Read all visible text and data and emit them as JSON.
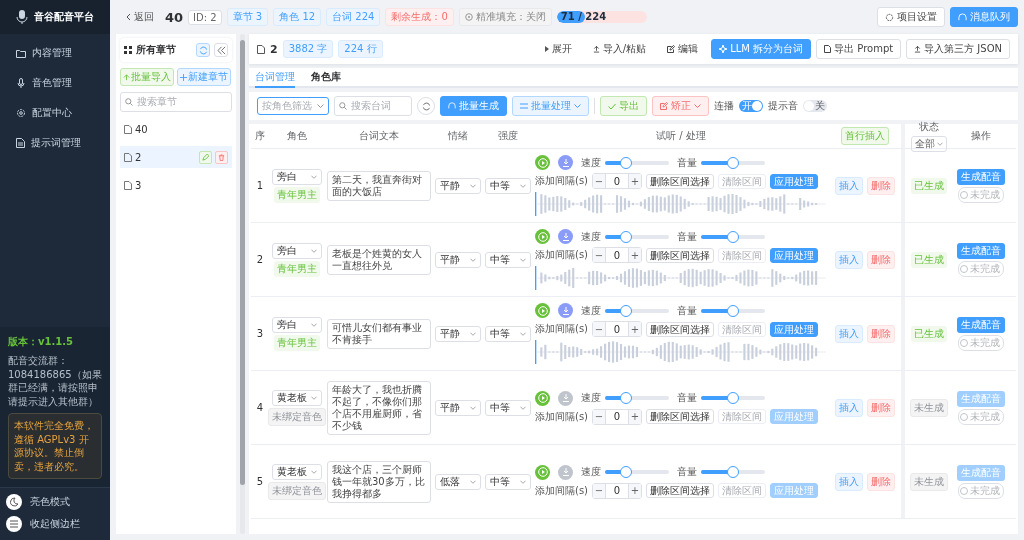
{
  "sidebar": {
    "logo": "音谷配音平台",
    "nav": [
      {
        "label": "内容管理",
        "kind": "folder",
        "selected": false
      },
      {
        "label": "音色管理",
        "kind": "mic",
        "selected": false
      },
      {
        "label": "配置中心",
        "kind": "gear",
        "selected": false
      },
      {
        "label": "提示词管理",
        "kind": "doc",
        "selected": false
      }
    ],
    "version": "版本：v1.1.5",
    "group_note": "配音交流群：1084186865（如果群已经满，请按照申请提示进入其他群）",
    "notice": "本软件完全免费，遵循 AGPLv3 开源协议。禁止倒卖，违者必究。",
    "bottom": [
      {
        "label": "亮色模式",
        "kind": "theme"
      },
      {
        "label": "收起侧边栏",
        "kind": "collapse"
      }
    ]
  },
  "topbar": {
    "back": "返回",
    "title": "40",
    "id": "ID: 2",
    "badges": [
      {
        "label": "章节 3",
        "kind": "info"
      },
      {
        "label": "角色 12",
        "kind": "info"
      },
      {
        "label": "台词 224",
        "kind": "info"
      },
      {
        "label": "剩余生成：0",
        "kind": "danger"
      }
    ],
    "precise": "精准填充：关闭",
    "progress": {
      "label": "71 / 224",
      "level": 0.317
    },
    "buttons": [
      {
        "label": "项目设置",
        "kind": "default"
      },
      {
        "label": "消息队列",
        "kind": "primary"
      }
    ]
  },
  "chapters": {
    "title": "所有章节",
    "import": "批量导入",
    "new": "新建章节",
    "search_placeholder": "搜索章节",
    "items": [
      {
        "name": "40",
        "selected": false
      },
      {
        "name": "2",
        "selected": true
      },
      {
        "name": "3",
        "selected": false
      }
    ]
  },
  "header": {
    "name": "2",
    "chars": "3882 字",
    "lines": "224 行",
    "actions": [
      {
        "label": "展开",
        "kind": "text"
      },
      {
        "label": "导入/粘贴",
        "kind": "text"
      },
      {
        "label": "编辑",
        "kind": "text"
      },
      {
        "label": "LLM 拆分为台词",
        "kind": "primary"
      },
      {
        "label": "导出 Prompt",
        "kind": "default"
      },
      {
        "label": "导入第三方 JSON",
        "kind": "default"
      }
    ]
  },
  "tabs": [
    {
      "label": "台词管理",
      "selected": true
    },
    {
      "label": "角色库",
      "selected": false
    }
  ],
  "toolbar": {
    "role_filter_placeholder": "按角色筛选",
    "search_placeholder": "搜索台词",
    "batch_generate": "批量生成",
    "batch_process": "批量处理",
    "export": "导出",
    "correct": "矫正",
    "autoplay": {
      "label": "连播",
      "text": "开",
      "on": true
    },
    "beep": {
      "label": "提示音",
      "text": "关",
      "on": false
    }
  },
  "table": {
    "columns": [
      "序",
      "角色",
      "台词文本",
      "情绪",
      "强度",
      "试听 / 处理"
    ],
    "insert_first": "首行插入",
    "status_column": "状态",
    "status_filter": "全部",
    "action_column": "操作",
    "rows": [
      {
        "index": "1",
        "role": "旁白",
        "voice": "青年男主",
        "voice_bound": true,
        "text": "第二天，我直奔街对面的大饭店",
        "emotion": "平静",
        "intensity": "中等",
        "has_audio": true,
        "speed_label": "速度",
        "speed": {
          "level": 0.33
        },
        "volume_label": "音量",
        "volume": {
          "level": 0.5
        },
        "gap_label": "添加间隔(s)",
        "minus": "−",
        "gap": "0",
        "plus": "+",
        "delete_range": "删除区间选择",
        "clear_range": "清除区间",
        "apply": "应用处理",
        "insert": "插入",
        "delete": "删除",
        "status": "已生成",
        "generated": true,
        "generate": "生成配音",
        "done": {
          "label": "未完成",
          "on": false
        }
      },
      {
        "index": "2",
        "role": "旁白",
        "voice": "青年男主",
        "voice_bound": true,
        "text": "老板是个姓黄的女人一直想往外兑",
        "emotion": "平静",
        "intensity": "中等",
        "has_audio": true,
        "speed_label": "速度",
        "speed": {
          "level": 0.33
        },
        "volume_label": "音量",
        "volume": {
          "level": 0.5
        },
        "gap_label": "添加间隔(s)",
        "minus": "−",
        "gap": "0",
        "plus": "+",
        "delete_range": "删除区间选择",
        "clear_range": "清除区间",
        "apply": "应用处理",
        "insert": "插入",
        "delete": "删除",
        "status": "已生成",
        "generated": true,
        "generate": "生成配音",
        "done": {
          "label": "未完成",
          "on": false
        }
      },
      {
        "index": "3",
        "role": "旁白",
        "voice": "青年男主",
        "voice_bound": true,
        "text": "可惜儿女们都有事业不肯接手",
        "emotion": "平静",
        "intensity": "中等",
        "has_audio": true,
        "speed_label": "速度",
        "speed": {
          "level": 0.33
        },
        "volume_label": "音量",
        "volume": {
          "level": 0.5
        },
        "gap_label": "添加间隔(s)",
        "minus": "−",
        "gap": "0",
        "plus": "+",
        "delete_range": "删除区间选择",
        "clear_range": "清除区间",
        "apply": "应用处理",
        "insert": "插入",
        "delete": "删除",
        "status": "已生成",
        "generated": true,
        "generate": "生成配音",
        "done": {
          "label": "未完成",
          "on": false
        }
      },
      {
        "index": "4",
        "role": "黄老板",
        "voice": "未绑定音色",
        "voice_bound": false,
        "text": "年龄大了，我也折腾不起了，不像你们那个店不用雇厨师，省不少钱",
        "emotion": "平静",
        "intensity": "中等",
        "has_audio": false,
        "speed_label": "速度",
        "speed": {
          "level": 0.33
        },
        "volume_label": "音量",
        "volume": {
          "level": 0.5
        },
        "gap_label": "添加间隔(s)",
        "minus": "−",
        "gap": "0",
        "plus": "+",
        "delete_range": "删除区间选择",
        "clear_range": "清除区间",
        "apply": "应用处理",
        "insert": "插入",
        "delete": "删除",
        "status": "未生成",
        "generated": false,
        "generate": "生成配音",
        "done": {
          "label": "未完成",
          "on": false
        }
      },
      {
        "index": "5",
        "role": "黄老板",
        "voice": "未绑定音色",
        "voice_bound": false,
        "text": "我这个店，三个厨师钱一年就30多万，比我挣得都多",
        "emotion": "低落",
        "intensity": "中等",
        "has_audio": false,
        "speed_label": "速度",
        "speed": {
          "level": 0.33
        },
        "volume_label": "音量",
        "volume": {
          "level": 0.5
        },
        "gap_label": "添加间隔(s)",
        "minus": "−",
        "gap": "0",
        "plus": "+",
        "delete_range": "删除区间选择",
        "clear_range": "清除区间",
        "apply": "应用处理",
        "insert": "插入",
        "delete": "删除",
        "status": "未生成",
        "generated": false,
        "generate": "生成配音",
        "done": {
          "label": "未完成",
          "on": false
        }
      }
    ]
  }
}
